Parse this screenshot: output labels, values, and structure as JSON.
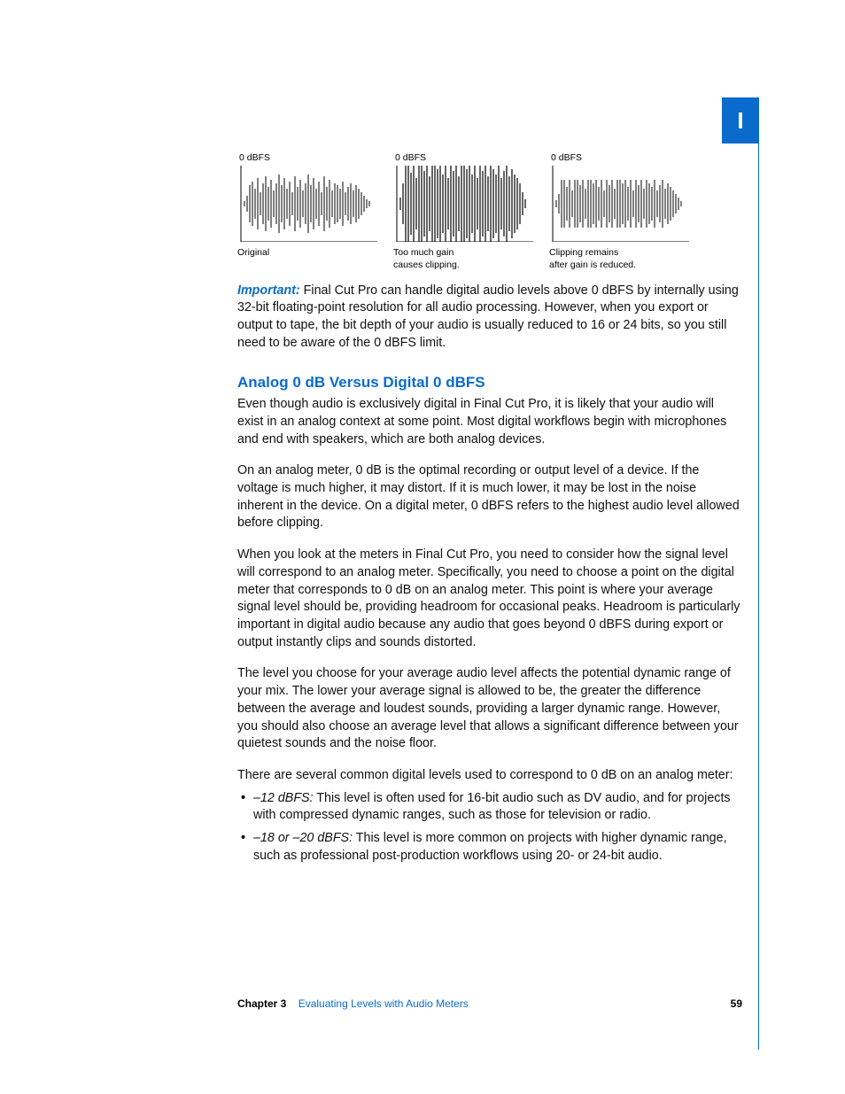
{
  "tab": "I",
  "waveforms": {
    "labels_top": [
      "0 dBFS",
      "0 dBFS",
      "0 dBFS"
    ],
    "captions": [
      "Original",
      "Too much gain\ncauses clipping.",
      "Clipping remains\nafter gain is reduced."
    ]
  },
  "important": {
    "lead": "Important:",
    "text": " Final Cut Pro can handle digital audio levels above 0 dBFS by internally using 32-bit floating-point resolution for all audio processing. However, when you export or output to tape, the bit depth of your audio is usually reduced to 16 or 24 bits, so you still need to be aware of the 0 dBFS limit."
  },
  "section": {
    "heading": "Analog 0 dB Versus Digital 0 dBFS",
    "p1": "Even though audio is exclusively digital in Final Cut Pro, it is likely that your audio will exist in an analog context at some point. Most digital workflows begin with microphones and end with speakers, which are both analog devices.",
    "p2": "On an analog meter, 0 dB is the optimal recording or output level of a device. If the voltage is much higher, it may distort. If it is much lower, it may be lost in the noise inherent in the device. On a digital meter, 0 dBFS refers to the highest audio level allowed before clipping.",
    "p3": "When you look at the meters in Final Cut Pro, you need to consider how the signal level will correspond to an analog meter. Specifically, you need to choose a point on the digital meter that corresponds to 0 dB on an analog meter. This point is where your average signal level should be, providing headroom for occasional peaks. Headroom is particularly important in digital audio because any audio that goes beyond 0 dBFS during export or output instantly clips and sounds distorted.",
    "p4": "The level you choose for your average audio level affects the potential dynamic range of your mix. The lower your average signal is allowed to be, the greater the difference between the average and loudest sounds, providing a larger dynamic range. However, you should also choose an average level that allows a significant difference between your quietest sounds and the noise floor.",
    "p5": "There are several common digital levels used to correspond to 0 dB on an analog meter:",
    "bullets": [
      {
        "key": "–12 dBFS:",
        "text": " This level is often used for 16-bit audio such as DV audio, and for projects with compressed dynamic ranges, such as those for television or radio."
      },
      {
        "key": "–18 or –20 dBFS:",
        "text": " This level is more common on projects with higher dynamic range, such as professional post-production workflows using 20- or 24-bit audio."
      }
    ]
  },
  "footer": {
    "chapter_label": "Chapter 3",
    "chapter_title": "Evaluating Levels with Audio Meters",
    "page": "59"
  }
}
